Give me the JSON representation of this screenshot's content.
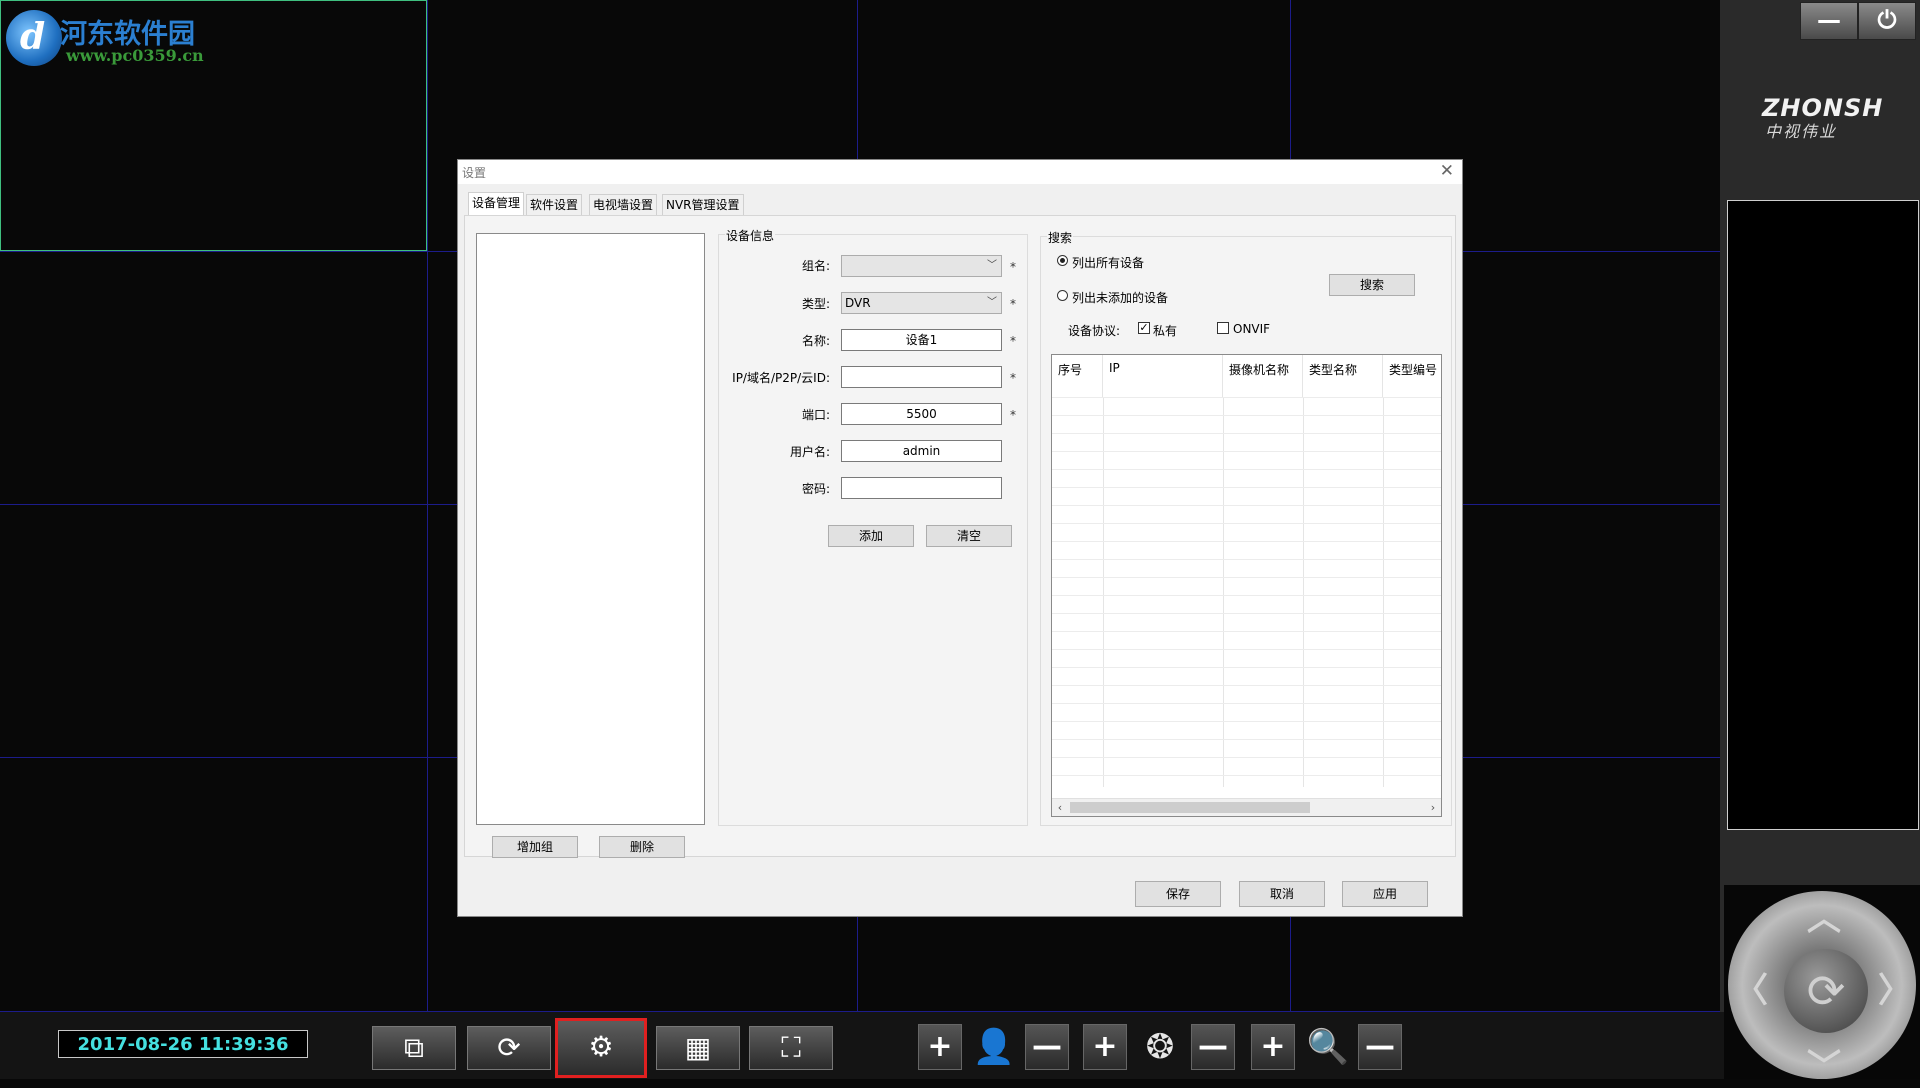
{
  "watermark": {
    "logo_glyph": "d",
    "title": "河东软件园",
    "url": "www.pc0359.cn"
  },
  "window_controls": {
    "minimize": "—",
    "power": "⏻"
  },
  "brand": {
    "name": "ZHONSH",
    "sub": "中视伟业"
  },
  "datetime": "2017-08-26 11:39:36",
  "toolbar": {
    "multi_window_icon": "multi-window-icon",
    "refresh_icon": "refresh-icon",
    "settings_icon": "gear-icon",
    "layout_icon": "grid-layout-icon",
    "fullscreen_icon": "fullscreen-icon"
  },
  "ptz_controls": {
    "focus_plus": "+",
    "focus_minus": "—",
    "iris_plus": "+",
    "iris_minus": "—",
    "zoom_plus": "+",
    "zoom_minus": "—"
  },
  "dialog": {
    "title": "设置",
    "close": "✕",
    "tabs": [
      "设备管理",
      "软件设置",
      "电视墙设置",
      "NVR管理设置"
    ],
    "group_buttons": {
      "add_group": "增加组",
      "delete": "删除"
    },
    "device_info": {
      "legend": "设备信息",
      "group_label": "组名:",
      "group_value": "",
      "type_label": "类型:",
      "type_value": "DVR",
      "name_label": "名称:",
      "name_value": "设备1",
      "ip_label": "IP/域名/P2P/云ID:",
      "ip_value": "",
      "port_label": "端口:",
      "port_value": "5500",
      "user_label": "用户名:",
      "user_value": "admin",
      "password_label": "密码:",
      "password_value": "",
      "required_mark": "*",
      "add_button": "添加",
      "clear_button": "清空"
    },
    "search": {
      "legend": "搜索",
      "option_all": "列出所有设备",
      "option_unadded": "列出未添加的设备",
      "selected_option": "all",
      "search_button": "搜索",
      "protocol_label": "设备协议:",
      "protocol_private": "私有",
      "protocol_private_checked": true,
      "protocol_onvif": "ONVIF",
      "protocol_onvif_checked": false,
      "columns": [
        "序号",
        "IP",
        "摄像机名称",
        "类型名称",
        "类型编号"
      ],
      "rows": []
    },
    "footer": {
      "save": "保存",
      "cancel": "取消",
      "apply": "应用"
    }
  }
}
